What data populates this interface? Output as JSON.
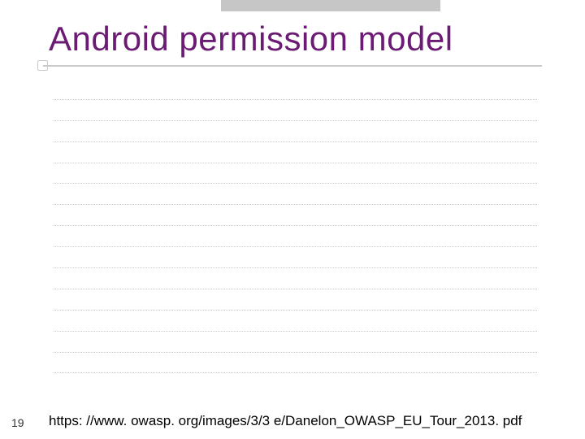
{
  "slide": {
    "title": "Android permission model",
    "page_number": "19",
    "footer_url": "https: //www. owasp. org/images/3/3 e/Danelon_OWASP_EU_Tour_2013. pdf",
    "body_line_count": 14
  }
}
